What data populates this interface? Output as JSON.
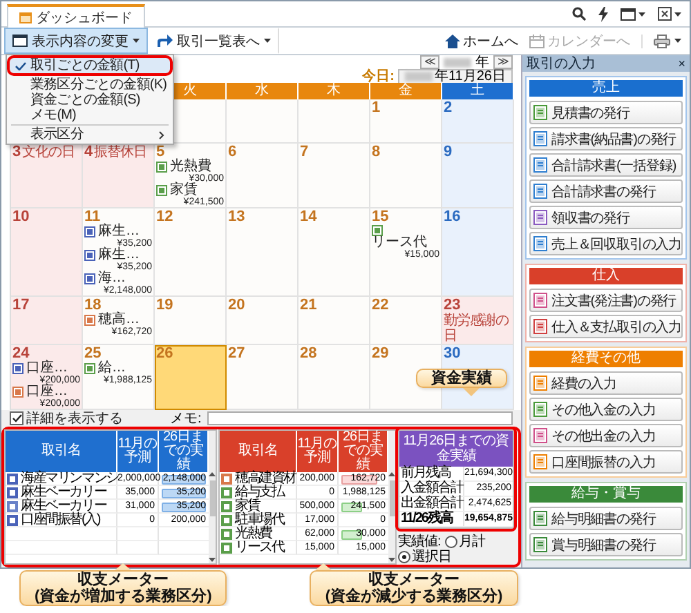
{
  "dashboard_tab": {
    "label": "ダッシュボード",
    "selected": true
  },
  "toolbar": {
    "buttons": [
      {
        "label": "表示内容の変更",
        "kind": "display",
        "expanded": true
      },
      {
        "label": "取引一覧表へ",
        "kind": "list",
        "expanded": false
      }
    ],
    "nav_links": [
      {
        "label": "ホームへ",
        "kind": "home",
        "disabled": false
      },
      {
        "label": "カレンダーへ",
        "kind": "calendar",
        "disabled": true
      }
    ]
  },
  "display_menu": {
    "items": [
      {
        "label": "取引ごとの金額(T)",
        "kind": "item",
        "checked": true,
        "annotated": true
      },
      {
        "label": "業務区分ごとの金額(K)",
        "kind": "item",
        "checked": false,
        "annotated": false
      },
      {
        "label": "資金ごとの金額(S)",
        "kind": "item",
        "checked": false,
        "annotated": false
      },
      {
        "label": "メモ(M)",
        "kind": "item",
        "checked": false,
        "annotated": false
      },
      {
        "label": "表示区分",
        "kind": "submenu",
        "checked": false,
        "annotated": false
      }
    ]
  },
  "calendar": {
    "prev": "≪",
    "year_text": "年",
    "next": "≫",
    "today_label": "今日:",
    "today_text": "年11月26日",
    "weekdays": [
      {
        "label": "火",
        "kind": "weekday"
      },
      {
        "label": "水",
        "kind": "weekday"
      },
      {
        "label": "木",
        "kind": "weekday"
      },
      {
        "label": "金",
        "kind": "weekday"
      },
      {
        "label": "土",
        "kind": "saturday"
      }
    ],
    "weeks": [
      [
        {
          "kind": "blank"
        },
        {
          "kind": "blank"
        },
        {
          "kind": "blank"
        },
        {
          "day": "1",
          "kind": "weekday",
          "today": false
        },
        {
          "day": "2",
          "kind": "saturday",
          "today": false
        }
      ],
      [
        {
          "day": "3",
          "kind": "holiday",
          "holiday": "文化の日",
          "today": false
        },
        {
          "day": "4",
          "kind": "holiday",
          "holiday": "振替休日",
          "today": false
        },
        {
          "day": "5",
          "kind": "weekday",
          "today": false,
          "entries": [
            {
              "label": "光熱費",
              "amount": "¥30,000",
              "color": "#5a9e4a"
            },
            {
              "label": "家賃",
              "amount": "¥241,500",
              "color": "#5a9e4a"
            }
          ]
        },
        {
          "day": "6",
          "kind": "weekday",
          "today": false
        },
        {
          "day": "7",
          "kind": "weekday",
          "today": false
        },
        {
          "day": "8",
          "kind": "weekday",
          "today": false
        },
        {
          "day": "9",
          "kind": "saturday",
          "today": false
        }
      ],
      [
        {
          "day": "10",
          "kind": "sunday",
          "today": false
        },
        {
          "day": "11",
          "kind": "weekday",
          "today": false,
          "entries": [
            {
              "label": "麻生…",
              "amount": "¥35,200",
              "color": "#4a62b8"
            },
            {
              "label": "麻生…",
              "amount": "¥35,200",
              "color": "#4a62b8"
            },
            {
              "label": "海…",
              "amount": "¥2,148,000",
              "color": "#4a62b8"
            }
          ]
        },
        {
          "day": "12",
          "kind": "weekday",
          "today": false
        },
        {
          "day": "13",
          "kind": "weekday",
          "today": false
        },
        {
          "day": "14",
          "kind": "weekday",
          "today": false
        },
        {
          "day": "15",
          "kind": "weekday",
          "today": false,
          "entries": [
            {
              "label": "リース代",
              "amount": "¥15,000",
              "color": "#5a9e4a"
            }
          ]
        },
        {
          "day": "16",
          "kind": "saturday",
          "today": false
        }
      ],
      [
        {
          "day": "17",
          "kind": "sunday",
          "today": false
        },
        {
          "day": "18",
          "kind": "weekday",
          "today": false,
          "entries": [
            {
              "label": "穂高…",
              "amount": "¥162,720",
              "color": "#d8784a"
            }
          ]
        },
        {
          "day": "19",
          "kind": "weekday",
          "today": false
        },
        {
          "day": "20",
          "kind": "weekday",
          "today": false
        },
        {
          "day": "21",
          "kind": "weekday",
          "today": false
        },
        {
          "day": "22",
          "kind": "weekday",
          "today": false
        },
        {
          "day": "23",
          "kind": "holiday",
          "holiday": "勤労感謝の日",
          "today": false
        }
      ],
      [
        {
          "day": "24",
          "kind": "sunday",
          "today": false,
          "entries": [
            {
              "label": "口座…",
              "amount": "¥200,000",
              "color": "#4a62b8"
            },
            {
              "label": "口座…",
              "amount": "¥200,000",
              "color": "#d8784a"
            }
          ]
        },
        {
          "day": "25",
          "kind": "weekday",
          "today": false,
          "entries": [
            {
              "label": "給…",
              "amount": "¥1,988,125",
              "color": "#5a9e4a"
            }
          ]
        },
        {
          "day": "26",
          "kind": "weekday",
          "today": true
        },
        {
          "day": "27",
          "kind": "weekday",
          "today": false
        },
        {
          "day": "28",
          "kind": "weekday",
          "today": false
        },
        {
          "day": "29",
          "kind": "weekday",
          "today": false
        },
        {
          "day": "30",
          "kind": "saturday",
          "today": false
        }
      ]
    ]
  },
  "show_details": {
    "label": "詳細を表示する",
    "checked": true
  },
  "memo": {
    "label": "メモ:"
  },
  "meters": {
    "annotated": true,
    "tables": [
      {
        "kind": "income",
        "columns": [
          "取引名",
          "11月の予測",
          "26日までの実績"
        ],
        "rows": [
          {
            "name": "海産マリンマンシ",
            "forecast": "2,000,000",
            "actual": "2,148,000",
            "level": 1,
            "alert": false,
            "color": "#4a62b8"
          },
          {
            "name": "麻生ベーカリー",
            "forecast": "35,000",
            "actual": "35,200",
            "level": 1,
            "alert": false,
            "color": "#4a62b8"
          },
          {
            "name": "麻生ベーカリー",
            "forecast": "31,000",
            "actual": "35,200",
            "level": 1,
            "alert": false,
            "color": "#6a82c8"
          },
          {
            "name": "口座間振替(入)",
            "forecast": "0",
            "actual": "200,000",
            "color": "#4a62b8"
          }
        ]
      },
      {
        "kind": "expense",
        "columns": [
          "取引名",
          "11月の予測",
          "26日までの実績"
        ],
        "rows": [
          {
            "name": "穂高建資材",
            "forecast": "200,000",
            "actual": "162,720",
            "level": 0.81,
            "alert": true,
            "color": "#d8784a"
          },
          {
            "name": "給与支払",
            "forecast": "0",
            "actual": "1,988,125",
            "color": "#5a9e4a"
          },
          {
            "name": "家賃",
            "forecast": "500,000",
            "actual": "241,500",
            "level": 0.48,
            "alert": false,
            "color": "#5a9e4a"
          },
          {
            "name": "駐車場代",
            "forecast": "17,000",
            "actual": "0",
            "color": "#5a9e4a"
          },
          {
            "name": "光熱費",
            "forecast": "62,000",
            "actual": "30,000",
            "level": 0.48,
            "alert": false,
            "color": "#5a9e4a"
          },
          {
            "name": "リース代",
            "forecast": "15,000",
            "actual": "15,000",
            "color": "#5a9e4a"
          }
        ]
      }
    ],
    "cash": {
      "title": "11月26日までの資金実績",
      "annotated": true,
      "rows": [
        {
          "label": "前月残高",
          "value": "21,694,300",
          "total": false
        },
        {
          "label": "入金額合計",
          "value": "235,200",
          "total": false
        },
        {
          "label": "出金額合計",
          "value": "2,474,625",
          "total": false
        },
        {
          "label": "11/26残高",
          "value": "19,654,875",
          "total": true
        }
      ],
      "basis": {
        "label": "実績値:",
        "options": [
          {
            "label": "月計",
            "selected": false
          },
          {
            "label": "選択日",
            "selected": true
          }
        ]
      }
    }
  },
  "side_panel": {
    "title": "取引の入力",
    "close": "×",
    "sections": [
      {
        "title": "売上",
        "color": "#1a6fcf",
        "items": [
          {
            "label": "見積書の発行",
            "color": "#4a9a3a"
          },
          {
            "label": "請求書(納品書)の発行",
            "color": "#2f7fd0"
          },
          {
            "label": "合計請求書(一括登録)",
            "color": "#2f7fd0"
          },
          {
            "label": "合計請求書の発行",
            "color": "#2f7fd0"
          },
          {
            "label": "領収書の発行",
            "color": "#8a5ac0"
          },
          {
            "label": "売上＆回収取引の入力",
            "color": "#2f7fd0"
          }
        ]
      },
      {
        "title": "仕入",
        "color": "#d9402a",
        "items": [
          {
            "label": "注文書(発注書)の発行",
            "color": "#d0508a"
          },
          {
            "label": "仕入＆支払取引の入力",
            "color": "#d04040"
          }
        ]
      },
      {
        "title": "経費その他",
        "color": "#ee7f00",
        "items": [
          {
            "label": "経費の入力",
            "color": "#ee7f00"
          },
          {
            "label": "その他入金の入力",
            "color": "#4a9a3a"
          },
          {
            "label": "その他出金の入力",
            "color": "#d0508a"
          },
          {
            "label": "口座間振替の入力",
            "color": "#ee7f00"
          }
        ]
      },
      {
        "title": "給与・賞与",
        "color": "#3a8a3a",
        "items": [
          {
            "label": "給与明細書の発行",
            "color": "#3a8a3a"
          },
          {
            "label": "賞与明細書の発行",
            "color": "#3a8a3a"
          }
        ]
      }
    ]
  },
  "annotations": [
    {
      "kind": "down",
      "lines": [
        "資金実績"
      ]
    },
    {
      "kind": "up",
      "lines": [
        "収支メーター",
        "(資金が増加する業務区分)"
      ]
    },
    {
      "kind": "up-left",
      "lines": [
        "収支メーター",
        "(資金が減少する業務区分)"
      ]
    }
  ]
}
